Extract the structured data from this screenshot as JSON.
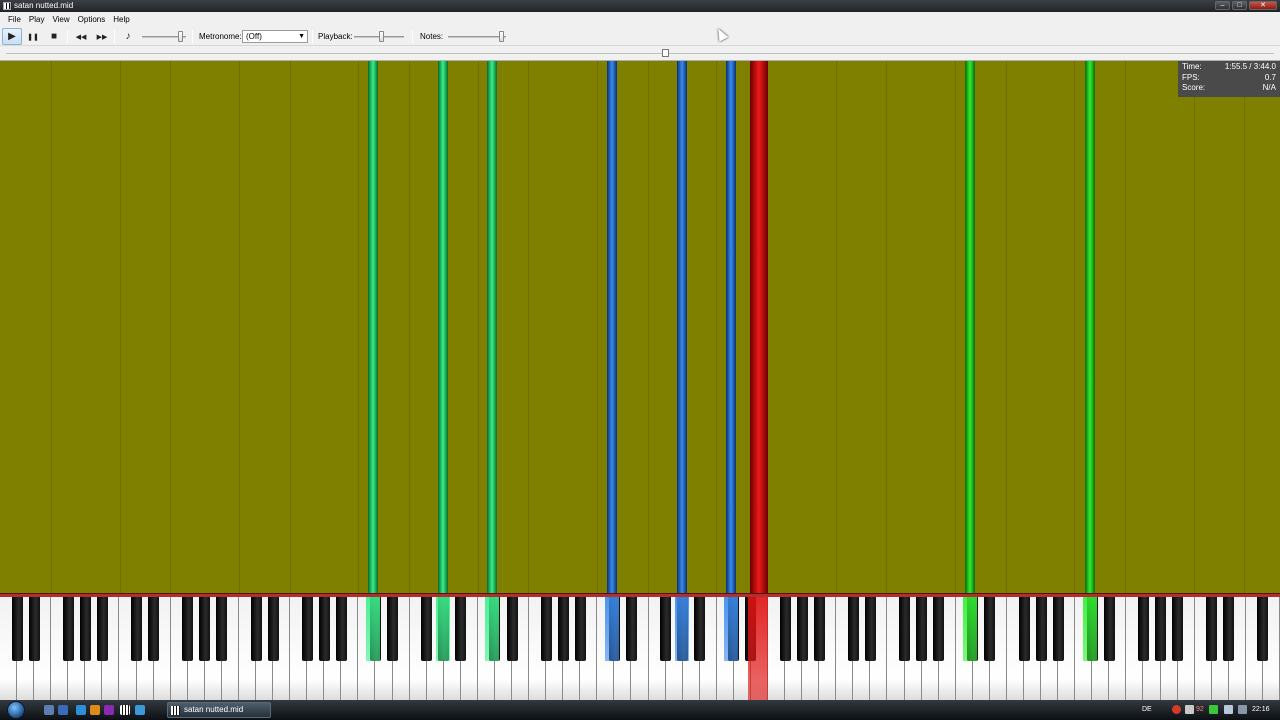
{
  "window": {
    "title": "satan nutted.mid",
    "minimize": "–",
    "maximize": "□",
    "close": "✕"
  },
  "menu": [
    "File",
    "Play",
    "View",
    "Options",
    "Help"
  ],
  "toolbar": {
    "play": "▶",
    "pause": "❚❚",
    "stop": "■",
    "rewind": "◀◀",
    "forward": "▶▶",
    "volume": "♪",
    "metronome_label": "Metronome:",
    "metronome_value": "(Off)",
    "playback_label": "Playback:",
    "notes_label": "Notes:"
  },
  "stats": {
    "time_label": "Time:",
    "time_value": "1:55.5 / 3:44.0",
    "fps_label": "FPS:",
    "fps_value": "0.7",
    "score_label": "Score:",
    "score_value": "N/A"
  },
  "taskbar": {
    "task_label": "satan nutted.mid",
    "lang": "DE",
    "tray_num": "92",
    "clock": "22:16"
  },
  "colors": {
    "background": "#808000",
    "green": "#22ee44",
    "teal_green": "#22dd66",
    "blue": "#2277dd",
    "red": "#dd1111"
  },
  "notes_on_keys": [
    {
      "color": "teal_green"
    },
    {
      "color": "teal_green"
    },
    {
      "color": "teal_green"
    },
    {
      "color": "blue"
    },
    {
      "color": "blue"
    },
    {
      "color": "blue"
    },
    {
      "color": "red"
    },
    {
      "color": "green"
    },
    {
      "color": "green"
    }
  ]
}
